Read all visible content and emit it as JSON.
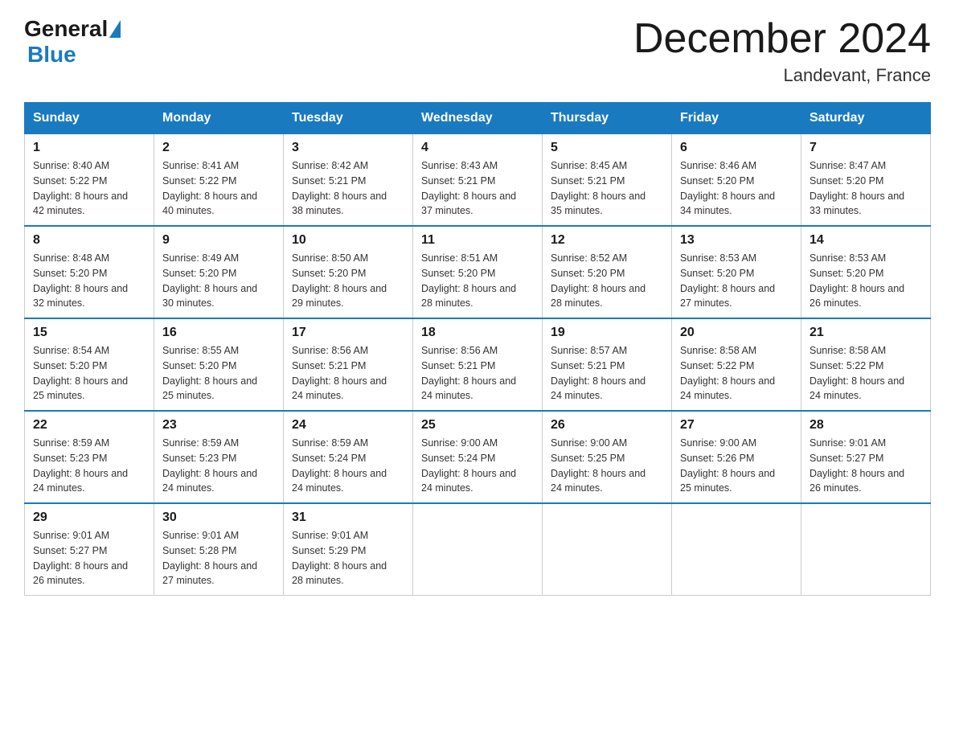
{
  "logo": {
    "general": "General",
    "blue": "Blue"
  },
  "title": "December 2024",
  "subtitle": "Landevant, France",
  "days_header": [
    "Sunday",
    "Monday",
    "Tuesday",
    "Wednesday",
    "Thursday",
    "Friday",
    "Saturday"
  ],
  "weeks": [
    [
      {
        "date": "1",
        "sunrise": "8:40 AM",
        "sunset": "5:22 PM",
        "daylight": "8 hours and 42 minutes."
      },
      {
        "date": "2",
        "sunrise": "8:41 AM",
        "sunset": "5:22 PM",
        "daylight": "8 hours and 40 minutes."
      },
      {
        "date": "3",
        "sunrise": "8:42 AM",
        "sunset": "5:21 PM",
        "daylight": "8 hours and 38 minutes."
      },
      {
        "date": "4",
        "sunrise": "8:43 AM",
        "sunset": "5:21 PM",
        "daylight": "8 hours and 37 minutes."
      },
      {
        "date": "5",
        "sunrise": "8:45 AM",
        "sunset": "5:21 PM",
        "daylight": "8 hours and 35 minutes."
      },
      {
        "date": "6",
        "sunrise": "8:46 AM",
        "sunset": "5:20 PM",
        "daylight": "8 hours and 34 minutes."
      },
      {
        "date": "7",
        "sunrise": "8:47 AM",
        "sunset": "5:20 PM",
        "daylight": "8 hours and 33 minutes."
      }
    ],
    [
      {
        "date": "8",
        "sunrise": "8:48 AM",
        "sunset": "5:20 PM",
        "daylight": "8 hours and 32 minutes."
      },
      {
        "date": "9",
        "sunrise": "8:49 AM",
        "sunset": "5:20 PM",
        "daylight": "8 hours and 30 minutes."
      },
      {
        "date": "10",
        "sunrise": "8:50 AM",
        "sunset": "5:20 PM",
        "daylight": "8 hours and 29 minutes."
      },
      {
        "date": "11",
        "sunrise": "8:51 AM",
        "sunset": "5:20 PM",
        "daylight": "8 hours and 28 minutes."
      },
      {
        "date": "12",
        "sunrise": "8:52 AM",
        "sunset": "5:20 PM",
        "daylight": "8 hours and 28 minutes."
      },
      {
        "date": "13",
        "sunrise": "8:53 AM",
        "sunset": "5:20 PM",
        "daylight": "8 hours and 27 minutes."
      },
      {
        "date": "14",
        "sunrise": "8:53 AM",
        "sunset": "5:20 PM",
        "daylight": "8 hours and 26 minutes."
      }
    ],
    [
      {
        "date": "15",
        "sunrise": "8:54 AM",
        "sunset": "5:20 PM",
        "daylight": "8 hours and 25 minutes."
      },
      {
        "date": "16",
        "sunrise": "8:55 AM",
        "sunset": "5:20 PM",
        "daylight": "8 hours and 25 minutes."
      },
      {
        "date": "17",
        "sunrise": "8:56 AM",
        "sunset": "5:21 PM",
        "daylight": "8 hours and 24 minutes."
      },
      {
        "date": "18",
        "sunrise": "8:56 AM",
        "sunset": "5:21 PM",
        "daylight": "8 hours and 24 minutes."
      },
      {
        "date": "19",
        "sunrise": "8:57 AM",
        "sunset": "5:21 PM",
        "daylight": "8 hours and 24 minutes."
      },
      {
        "date": "20",
        "sunrise": "8:58 AM",
        "sunset": "5:22 PM",
        "daylight": "8 hours and 24 minutes."
      },
      {
        "date": "21",
        "sunrise": "8:58 AM",
        "sunset": "5:22 PM",
        "daylight": "8 hours and 24 minutes."
      }
    ],
    [
      {
        "date": "22",
        "sunrise": "8:59 AM",
        "sunset": "5:23 PM",
        "daylight": "8 hours and 24 minutes."
      },
      {
        "date": "23",
        "sunrise": "8:59 AM",
        "sunset": "5:23 PM",
        "daylight": "8 hours and 24 minutes."
      },
      {
        "date": "24",
        "sunrise": "8:59 AM",
        "sunset": "5:24 PM",
        "daylight": "8 hours and 24 minutes."
      },
      {
        "date": "25",
        "sunrise": "9:00 AM",
        "sunset": "5:24 PM",
        "daylight": "8 hours and 24 minutes."
      },
      {
        "date": "26",
        "sunrise": "9:00 AM",
        "sunset": "5:25 PM",
        "daylight": "8 hours and 24 minutes."
      },
      {
        "date": "27",
        "sunrise": "9:00 AM",
        "sunset": "5:26 PM",
        "daylight": "8 hours and 25 minutes."
      },
      {
        "date": "28",
        "sunrise": "9:01 AM",
        "sunset": "5:27 PM",
        "daylight": "8 hours and 26 minutes."
      }
    ],
    [
      {
        "date": "29",
        "sunrise": "9:01 AM",
        "sunset": "5:27 PM",
        "daylight": "8 hours and 26 minutes."
      },
      {
        "date": "30",
        "sunrise": "9:01 AM",
        "sunset": "5:28 PM",
        "daylight": "8 hours and 27 minutes."
      },
      {
        "date": "31",
        "sunrise": "9:01 AM",
        "sunset": "5:29 PM",
        "daylight": "8 hours and 28 minutes."
      },
      null,
      null,
      null,
      null
    ]
  ],
  "labels": {
    "sunrise": "Sunrise: ",
    "sunset": "Sunset: ",
    "daylight": "Daylight: "
  }
}
